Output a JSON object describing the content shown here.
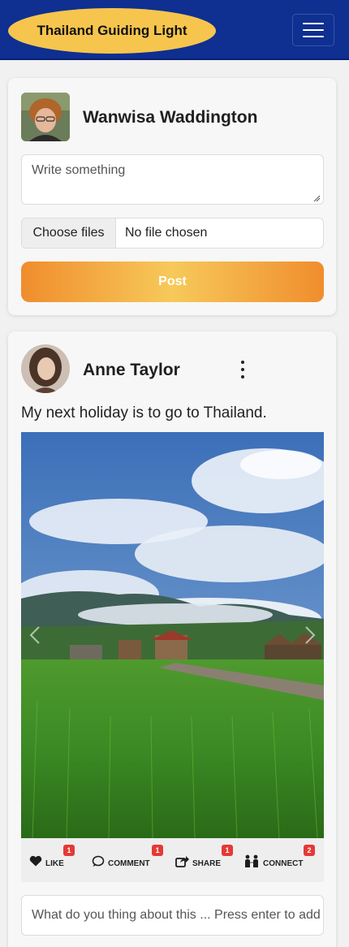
{
  "navbar": {
    "brand": "Thailand Guiding Light",
    "menu_icon": "hamburger-icon",
    "color": "#0f2f91",
    "brand_color": "#f6c54d"
  },
  "composer": {
    "user_name": "Wanwisa Waddington",
    "textarea_placeholder": "Write something",
    "file_button": "Choose files",
    "file_status": "No file chosen",
    "post_button": "Post"
  },
  "post": {
    "author": "Anne Taylor",
    "text": "My next holiday is to go to Thailand.",
    "actions": [
      {
        "label": "LIKE",
        "count": "1",
        "icon": "heart-icon"
      },
      {
        "label": "COMMENT",
        "count": "1",
        "icon": "comment-icon"
      },
      {
        "label": "SHARE",
        "count": "1",
        "icon": "share-icon"
      },
      {
        "label": "CONNECT",
        "count": "2",
        "icon": "connect-icon"
      }
    ],
    "comment_placeholder": "What do you thing about this ... Press enter to add"
  },
  "colors": {
    "badge": "#e53935",
    "post_button_gradient": [
      "#f08d2d",
      "#f7c95a"
    ]
  }
}
